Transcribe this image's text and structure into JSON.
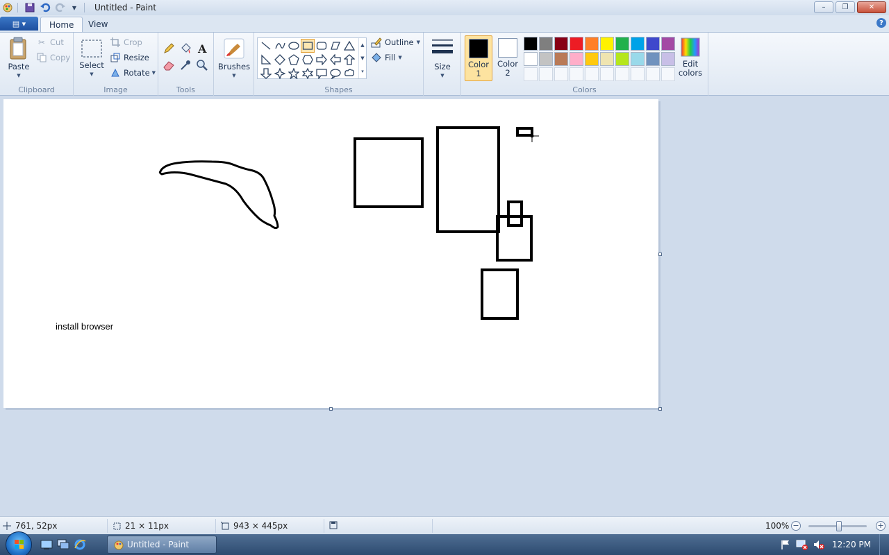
{
  "window": {
    "title": "Untitled - Paint",
    "minimize_label": "–",
    "restore_label": "❐",
    "close_label": "✕"
  },
  "ribbon_tabs": {
    "menu_label": "▤ ▾",
    "home": "Home",
    "view": "View",
    "help": "?"
  },
  "clipboard": {
    "label": "Clipboard",
    "paste": "Paste",
    "cut": "Cut",
    "copy": "Copy"
  },
  "image": {
    "label": "Image",
    "select": "Select",
    "crop": "Crop",
    "resize": "Resize",
    "rotate": "Rotate"
  },
  "tools": {
    "label": "Tools"
  },
  "brushes": {
    "label": "Brushes"
  },
  "shapes": {
    "label": "Shapes",
    "outline": "Outline",
    "fill": "Fill"
  },
  "size": {
    "label": "Size"
  },
  "colors": {
    "label": "Colors",
    "color1_line1": "Color",
    "color1_line2": "1",
    "color2_line1": "Color",
    "color2_line2": "2",
    "edit_line1": "Edit",
    "edit_line2": "colors",
    "color1_value": "#000000",
    "color2_value": "#ffffff",
    "palette": [
      "#000000",
      "#7f7f7f",
      "#880015",
      "#ed1c24",
      "#ff7f27",
      "#fff200",
      "#22b14c",
      "#00a2e8",
      "#3f48cc",
      "#a349a4",
      "#ffffff",
      "#c3c3c3",
      "#b97a57",
      "#ffaec9",
      "#ffc90e",
      "#efe4b0",
      "#b5e61d",
      "#99d9ea",
      "#7092be",
      "#c8bfe7"
    ]
  },
  "canvas": {
    "text": "install browser"
  },
  "status": {
    "cursor_pos": "761, 52px",
    "selection_size": "21 × 11px",
    "canvas_size": "943 × 445px",
    "zoom": "100%",
    "zoom_out": "−",
    "zoom_in": "+"
  },
  "taskbar": {
    "task_label": "Untitled - Paint",
    "clock": "12:20 PM"
  }
}
